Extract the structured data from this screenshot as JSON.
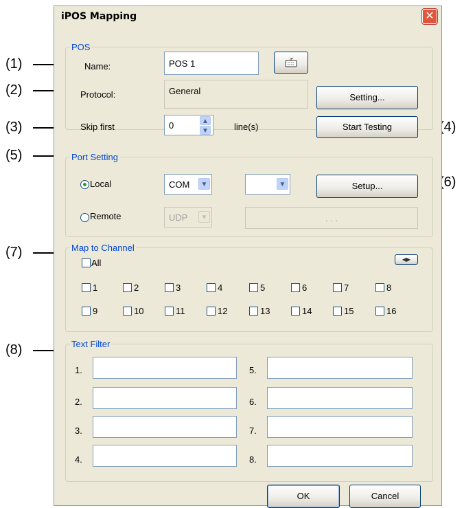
{
  "dialog": {
    "title": "iPOS Mapping",
    "close_glyph": "✕"
  },
  "callouts": [
    "(1)",
    "(2)",
    "(3)",
    "(4)",
    "(5)",
    "(6)",
    "(7)",
    "(8)"
  ],
  "pos": {
    "legend": "POS",
    "name_label": "Name:",
    "name_value": "POS 1",
    "protocol_label": "Protocol:",
    "protocol_value": "General",
    "setting_button": "Setting...",
    "skip_label": "Skip  first",
    "skip_value": "0",
    "skip_unit": "line(s)",
    "start_testing_button": "Start Testing",
    "keyboard_icon": "keyboard-icon"
  },
  "port": {
    "legend": "Port Setting",
    "local_label": "Local",
    "local_selected": true,
    "local_type": "COM",
    "local_port": "",
    "setup_button": "Setup...",
    "remote_label": "Remote",
    "remote_type": "UDP",
    "remote_ip": ".    .    ."
  },
  "map": {
    "legend": "Map to Channel",
    "all_label": "All",
    "channels": [
      "1",
      "2",
      "3",
      "4",
      "5",
      "6",
      "7",
      "8",
      "9",
      "10",
      "11",
      "12",
      "13",
      "14",
      "15",
      "16"
    ]
  },
  "filter": {
    "legend": "Text Filter",
    "items": [
      "1.",
      "2.",
      "3.",
      "4.",
      "5.",
      "6.",
      "7.",
      "8."
    ]
  },
  "buttons": {
    "ok": "OK",
    "cancel": "Cancel"
  }
}
